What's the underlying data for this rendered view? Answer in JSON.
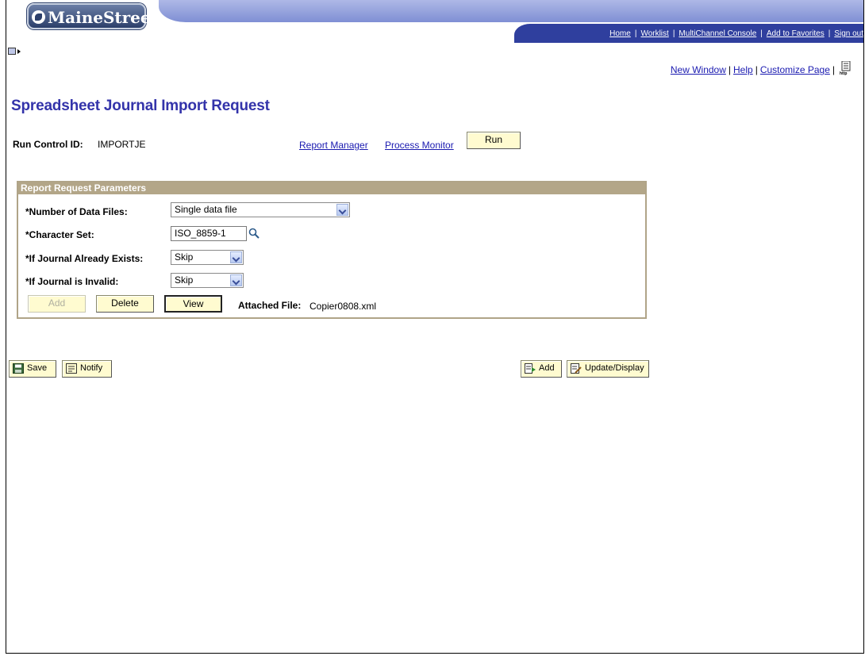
{
  "header": {
    "logo_text": "MaineStreet",
    "nav": [
      {
        "label": "Home"
      },
      {
        "label": "Worklist"
      },
      {
        "label": "MultiChannel Console"
      },
      {
        "label": "Add to Favorites"
      },
      {
        "label": "Sign out"
      }
    ]
  },
  "page_links": {
    "new_window": "New Window",
    "help": "Help",
    "customize_page": "Customize Page",
    "separator": "|"
  },
  "page": {
    "title": "Spreadsheet Journal Import Request",
    "run_control_label": "Run Control ID:",
    "run_control_value": "IMPORTJE",
    "report_manager": "Report Manager",
    "process_monitor": "Process Monitor",
    "run_button": "Run"
  },
  "params": {
    "header": "Report Request Parameters",
    "num_files_label": "*Number of Data Files:",
    "num_files_value": "Single data file",
    "charset_label": "*Character Set:",
    "charset_value": "ISO_8859-1",
    "journal_exists_label": "*If Journal Already Exists:",
    "journal_exists_value": "Skip",
    "journal_invalid_label": "*If Journal is Invalid:",
    "journal_invalid_value": "Skip",
    "add_button": "Add",
    "delete_button": "Delete",
    "view_button": "View",
    "attached_label": "Attached File:",
    "attached_value": "Copier0808.xml"
  },
  "toolbar": {
    "save": "Save",
    "notify": "Notify",
    "add": "Add",
    "update_display": "Update/Display"
  },
  "colors": {
    "title": "#3333aa",
    "link": "#1a1ab0",
    "group_header": "#b3a688",
    "button_bg": "#fffbd0",
    "nav_bar": "#2f3f9e"
  }
}
